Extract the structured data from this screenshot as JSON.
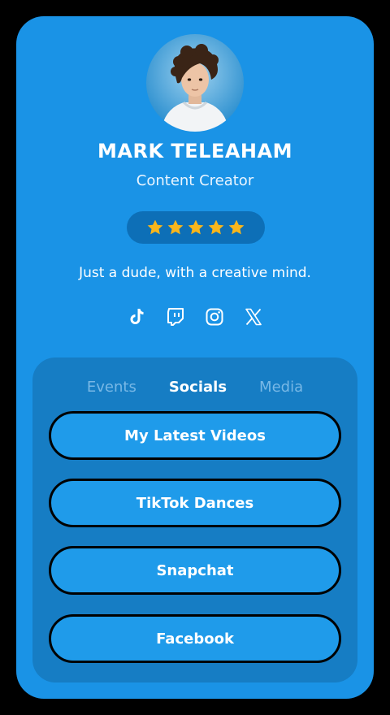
{
  "profile": {
    "name": "MARK TELEAHAM",
    "role": "Content Creator",
    "bio": "Just a dude, with a creative mind.",
    "rating": 5
  },
  "socials": [
    {
      "icon": "tiktok-icon"
    },
    {
      "icon": "twitch-icon"
    },
    {
      "icon": "instagram-icon"
    },
    {
      "icon": "x-icon"
    }
  ],
  "tabs": [
    {
      "label": "Events",
      "active": false
    },
    {
      "label": "Socials",
      "active": true
    },
    {
      "label": "Media",
      "active": false
    }
  ],
  "links": [
    {
      "label": "My Latest Videos"
    },
    {
      "label": "TikTok Dances"
    },
    {
      "label": "Snapchat"
    },
    {
      "label": "Facebook"
    }
  ],
  "colors": {
    "background": "#1a93e6",
    "panel": "#167dc4",
    "button": "#1f9bea",
    "star": "#f8b61c"
  }
}
